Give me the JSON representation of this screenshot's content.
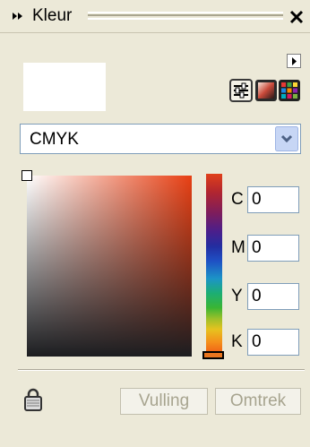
{
  "panel": {
    "title": "Kleur",
    "icons": {
      "collapse": "double-chevron-icon",
      "close": "close-icon"
    }
  },
  "toolbar": {
    "flyout_icon": "flyout-arrow-icon",
    "viewers": [
      {
        "name": "sliders-icon"
      },
      {
        "name": "color-viewer-icon"
      },
      {
        "name": "palette-grid-icon"
      }
    ]
  },
  "model": {
    "selected": "CMYK"
  },
  "channels": [
    {
      "label": "C",
      "value": "0"
    },
    {
      "label": "M",
      "value": "0"
    },
    {
      "label": "Y",
      "value": "0"
    },
    {
      "label": "K",
      "value": "0"
    }
  ],
  "buttons": {
    "fill": "Vulling",
    "outline": "Omtrek"
  },
  "colors": {
    "accent": "#e83f13",
    "dark": "#1c1d20",
    "panel": "#ece9d8"
  }
}
